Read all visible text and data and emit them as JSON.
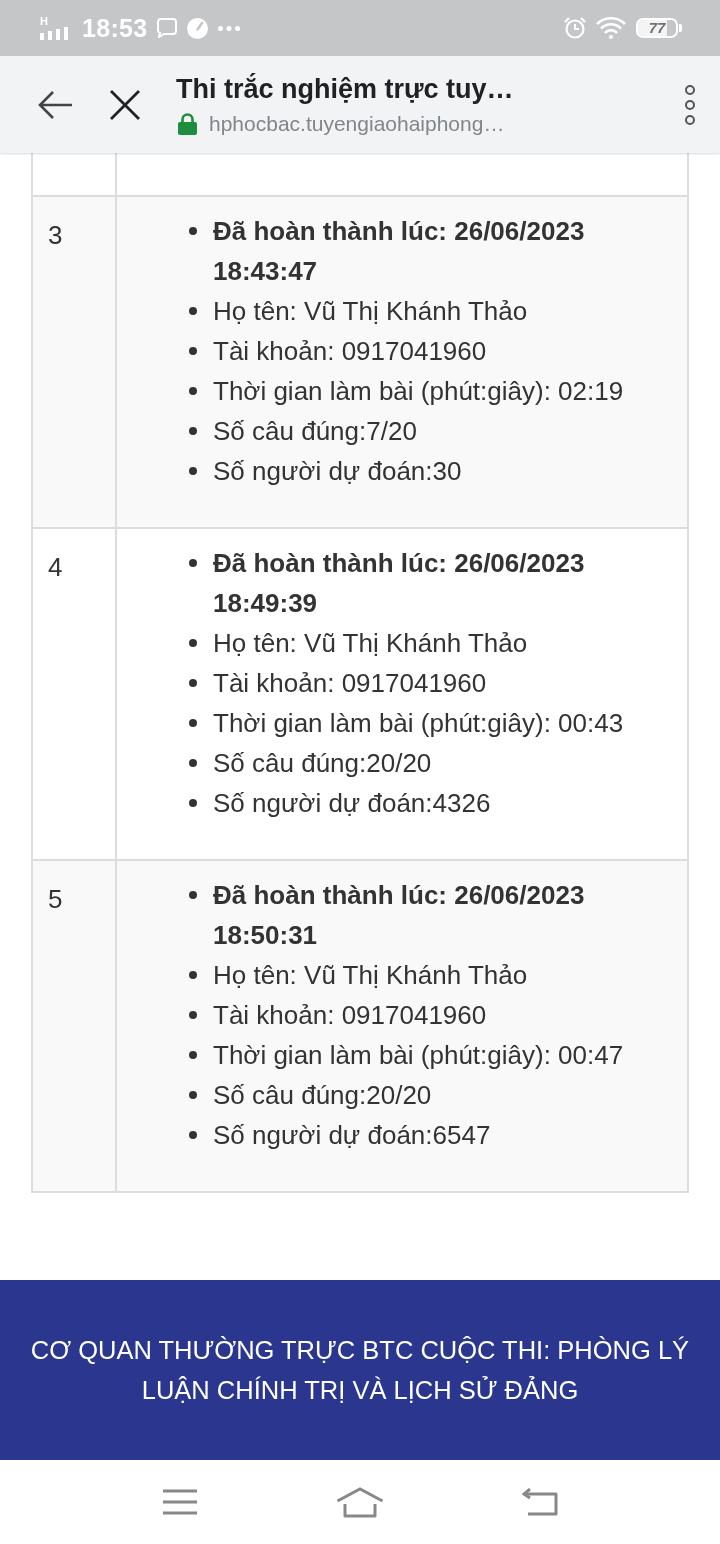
{
  "status_bar": {
    "network": "H",
    "time": "18:53",
    "battery": {
      "label": "77",
      "level": 0.77
    }
  },
  "browser": {
    "title": "Thi trắc nghiệm trực tuy…",
    "url": "hphocbac.tuyengiaohaiphong…",
    "secure": true
  },
  "table": {
    "rows": [
      {
        "number": "3",
        "completed": "Đã hoàn thành lúc: 26/06/2023 18:43:47",
        "details": [
          "Họ tên: Vũ Thị Khánh Thảo",
          "Tài khoản: 0917041960",
          "Thời gian làm bài (phút:giây): 02:19",
          "Số câu đúng:7/20",
          "Số người dự đoán:30"
        ]
      },
      {
        "number": "4",
        "completed": "Đã hoàn thành lúc: 26/06/2023 18:49:39",
        "details": [
          "Họ tên: Vũ Thị Khánh Thảo",
          "Tài khoản: 0917041960",
          "Thời gian làm bài (phút:giây): 00:43",
          "Số câu đúng:20/20",
          "Số người dự đoán:4326"
        ]
      },
      {
        "number": "5",
        "completed": "Đã hoàn thành lúc: 26/06/2023 18:50:31",
        "details": [
          "Họ tên: Vũ Thị Khánh Thảo",
          "Tài khoản: 0917041960",
          "Thời gian làm bài (phút:giây): 00:47",
          "Số câu đúng:20/20",
          "Số người dự đoán:6547"
        ]
      }
    ]
  },
  "footer": {
    "text": "CƠ QUAN THƯỜNG TRỰC BTC CUỘC THI: PHÒNG LÝ LUẬN CHÍNH TRỊ VÀ LỊCH SỬ ĐẢNG"
  }
}
